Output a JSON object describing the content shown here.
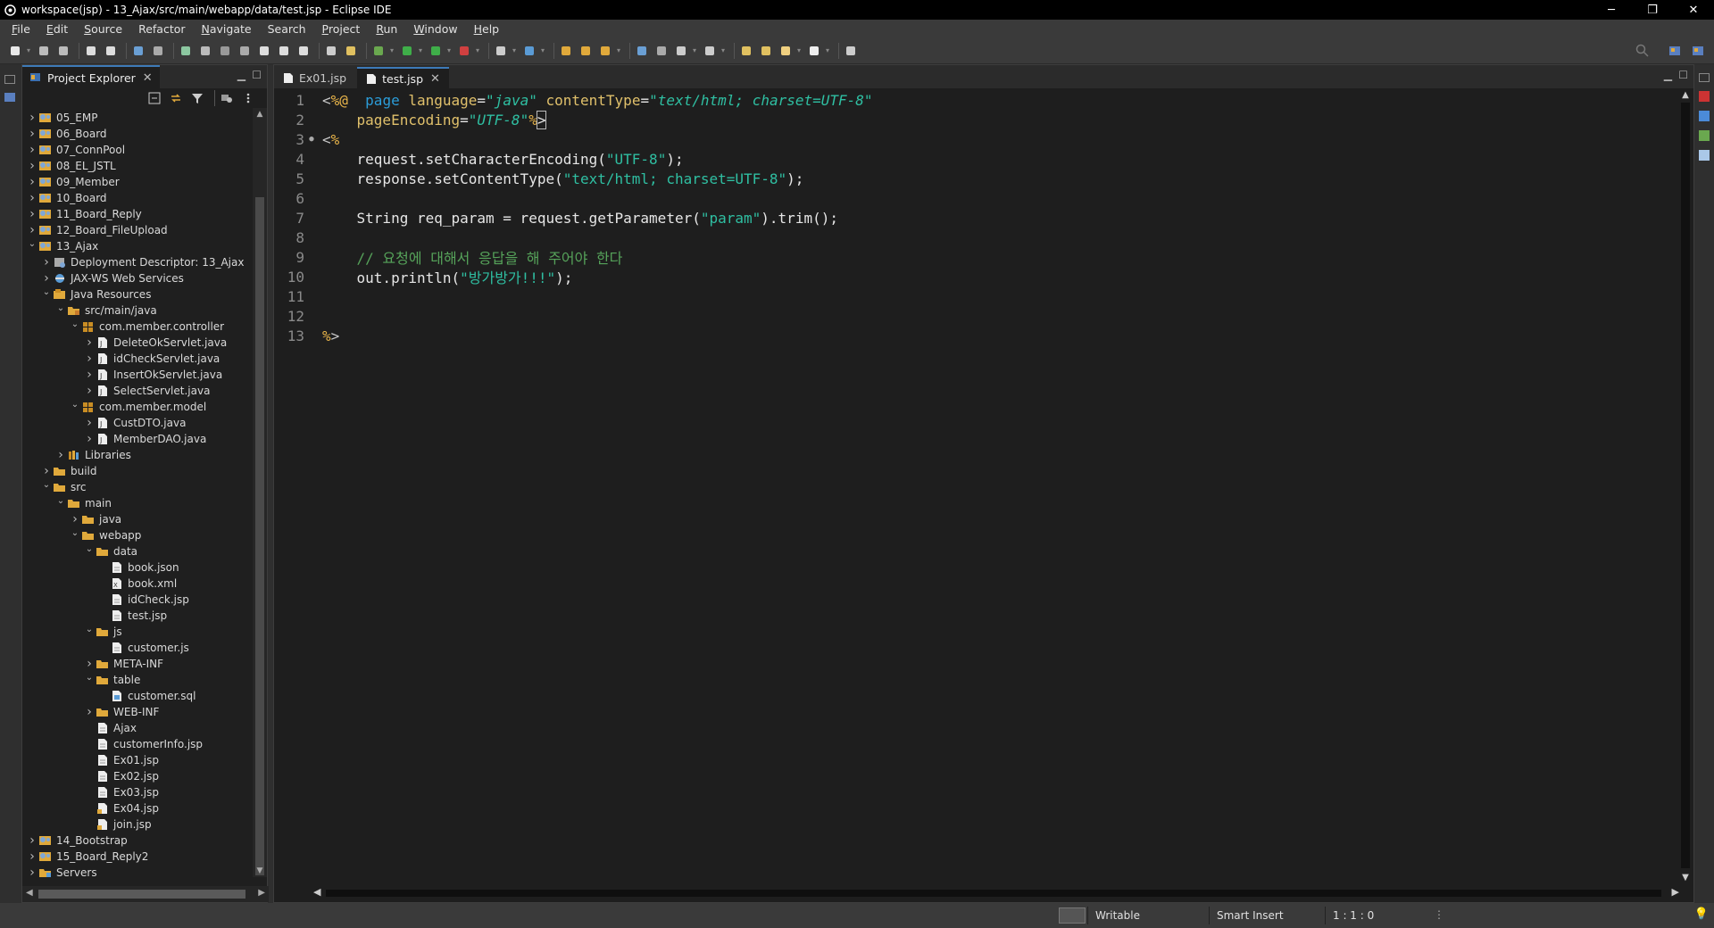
{
  "window": {
    "title": "workspace(jsp) - 13_Ajax/src/main/webapp/data/test.jsp - Eclipse IDE",
    "minimize": "─",
    "restore": "❐",
    "close": "✕"
  },
  "menu": [
    {
      "label": "File",
      "mnemonic": "F",
      "rest": "ile"
    },
    {
      "label": "Edit",
      "mnemonic": "E",
      "rest": "dit"
    },
    {
      "label": "Source",
      "mnemonic": "S",
      "rest": "ource"
    },
    {
      "label": "Refactor",
      "mnemonic": "",
      "rest": "Refactor"
    },
    {
      "label": "Navigate",
      "mnemonic": "N",
      "rest": "avigate"
    },
    {
      "label": "Search",
      "mnemonic": "",
      "rest": "Search"
    },
    {
      "label": "Project",
      "mnemonic": "P",
      "rest": "roject"
    },
    {
      "label": "Run",
      "mnemonic": "R",
      "rest": "un"
    },
    {
      "label": "Window",
      "mnemonic": "W",
      "rest": "indow"
    },
    {
      "label": "Help",
      "mnemonic": "H",
      "rest": "elp"
    }
  ],
  "explorer": {
    "tab_label": "Project Explorer",
    "tree": [
      {
        "label": "05_EMP",
        "depth": 0,
        "expanded": false,
        "icon": "project-icon"
      },
      {
        "label": "06_Board",
        "depth": 0,
        "expanded": false,
        "icon": "project-icon"
      },
      {
        "label": "07_ConnPool",
        "depth": 0,
        "expanded": false,
        "icon": "project-icon"
      },
      {
        "label": "08_EL_JSTL",
        "depth": 0,
        "expanded": false,
        "icon": "project-icon"
      },
      {
        "label": "09_Member",
        "depth": 0,
        "expanded": false,
        "icon": "project-icon"
      },
      {
        "label": "10_Board",
        "depth": 0,
        "expanded": false,
        "icon": "project-icon"
      },
      {
        "label": "11_Board_Reply",
        "depth": 0,
        "expanded": false,
        "icon": "project-icon"
      },
      {
        "label": "12_Board_FileUpload",
        "depth": 0,
        "expanded": false,
        "icon": "project-icon"
      },
      {
        "label": "13_Ajax",
        "depth": 0,
        "expanded": true,
        "icon": "project-icon"
      },
      {
        "label": "Deployment Descriptor: 13_Ajax",
        "depth": 1,
        "expanded": false,
        "icon": "descriptor-icon"
      },
      {
        "label": "JAX-WS Web Services",
        "depth": 1,
        "expanded": false,
        "icon": "webservice-icon"
      },
      {
        "label": "Java Resources",
        "depth": 1,
        "expanded": true,
        "icon": "java-resources-icon"
      },
      {
        "label": "src/main/java",
        "depth": 2,
        "expanded": true,
        "icon": "source-folder-icon"
      },
      {
        "label": "com.member.controller",
        "depth": 3,
        "expanded": true,
        "icon": "package-icon"
      },
      {
        "label": "DeleteOkServlet.java",
        "depth": 4,
        "expanded": false,
        "icon": "java-file-icon"
      },
      {
        "label": "idCheckServlet.java",
        "depth": 4,
        "expanded": false,
        "icon": "java-file-icon"
      },
      {
        "label": "InsertOkServlet.java",
        "depth": 4,
        "expanded": false,
        "icon": "java-file-icon"
      },
      {
        "label": "SelectServlet.java",
        "depth": 4,
        "expanded": false,
        "icon": "java-file-icon"
      },
      {
        "label": "com.member.model",
        "depth": 3,
        "expanded": true,
        "icon": "package-icon"
      },
      {
        "label": "CustDTO.java",
        "depth": 4,
        "expanded": false,
        "icon": "java-file-icon"
      },
      {
        "label": "MemberDAO.java",
        "depth": 4,
        "expanded": false,
        "icon": "java-file-icon"
      },
      {
        "label": "Libraries",
        "depth": 2,
        "expanded": false,
        "icon": "library-icon"
      },
      {
        "label": "build",
        "depth": 1,
        "expanded": false,
        "icon": "folder-icon"
      },
      {
        "label": "src",
        "depth": 1,
        "expanded": true,
        "icon": "folder-icon"
      },
      {
        "label": "main",
        "depth": 2,
        "expanded": true,
        "icon": "folder-icon"
      },
      {
        "label": "java",
        "depth": 3,
        "expanded": false,
        "icon": "folder-icon"
      },
      {
        "label": "webapp",
        "depth": 3,
        "expanded": true,
        "icon": "folder-icon"
      },
      {
        "label": "data",
        "depth": 4,
        "expanded": true,
        "icon": "folder-icon"
      },
      {
        "label": "book.json",
        "depth": 5,
        "leaf": true,
        "icon": "file-icon"
      },
      {
        "label": "book.xml",
        "depth": 5,
        "leaf": true,
        "icon": "xml-file-icon"
      },
      {
        "label": "idCheck.jsp",
        "depth": 5,
        "leaf": true,
        "icon": "file-icon"
      },
      {
        "label": "test.jsp",
        "depth": 5,
        "leaf": true,
        "icon": "file-icon"
      },
      {
        "label": "js",
        "depth": 4,
        "expanded": true,
        "icon": "folder-icon"
      },
      {
        "label": "customer.js",
        "depth": 5,
        "leaf": true,
        "icon": "file-icon"
      },
      {
        "label": "META-INF",
        "depth": 4,
        "expanded": false,
        "icon": "folder-icon"
      },
      {
        "label": "table",
        "depth": 4,
        "expanded": true,
        "icon": "folder-icon"
      },
      {
        "label": "customer.sql",
        "depth": 5,
        "leaf": true,
        "icon": "sql-file-icon"
      },
      {
        "label": "WEB-INF",
        "depth": 4,
        "expanded": false,
        "icon": "folder-icon"
      },
      {
        "label": "Ajax",
        "depth": 4,
        "leaf": true,
        "icon": "file-icon"
      },
      {
        "label": "customerInfo.jsp",
        "depth": 4,
        "leaf": true,
        "icon": "file-icon"
      },
      {
        "label": "Ex01.jsp",
        "depth": 4,
        "leaf": true,
        "icon": "file-icon"
      },
      {
        "label": "Ex02.jsp",
        "depth": 4,
        "leaf": true,
        "icon": "file-icon"
      },
      {
        "label": "Ex03.jsp",
        "depth": 4,
        "leaf": true,
        "icon": "file-icon"
      },
      {
        "label": "Ex04.jsp",
        "depth": 4,
        "leaf": true,
        "icon": "jsp-warning-file-icon"
      },
      {
        "label": "join.jsp",
        "depth": 4,
        "leaf": true,
        "icon": "jsp-warning-file-icon"
      },
      {
        "label": "14_Bootstrap",
        "depth": 0,
        "expanded": false,
        "icon": "project-icon"
      },
      {
        "label": "15_Board_Reply2",
        "depth": 0,
        "expanded": false,
        "icon": "project-icon"
      },
      {
        "label": "Servers",
        "depth": 0,
        "expanded": false,
        "icon": "servers-icon"
      }
    ]
  },
  "editor": {
    "tabs": [
      {
        "label": "Ex01.jsp",
        "active": false
      },
      {
        "label": "test.jsp",
        "active": true
      }
    ],
    "lines": [
      {
        "n": "1",
        "fold": "",
        "tokens": [
          [
            "k-tag",
            "<"
          ],
          [
            "k-pct",
            "%@"
          ],
          [
            "",
            "  "
          ],
          [
            "k-dir",
            "page"
          ],
          [
            "",
            " "
          ],
          [
            "k-attr",
            "language"
          ],
          [
            "",
            "="
          ],
          [
            "k-str",
            "\"java\""
          ],
          [
            "",
            " "
          ],
          [
            "k-attr",
            "contentType"
          ],
          [
            "",
            "="
          ],
          [
            "k-str",
            "\"text/html; charset=UTF-8\""
          ]
        ]
      },
      {
        "n": "2",
        "fold": "",
        "tokens": [
          [
            "",
            "    "
          ],
          [
            "k-attr",
            "pageEncoding"
          ],
          [
            "",
            "="
          ],
          [
            "k-str",
            "\"UTF-8\""
          ],
          [
            "k-pct",
            "%"
          ],
          [
            "caret-box",
            ">"
          ]
        ]
      },
      {
        "n": "3",
        "fold": "●",
        "tokens": [
          [
            "k-tag",
            "<"
          ],
          [
            "k-pct",
            "%"
          ]
        ]
      },
      {
        "n": "4",
        "fold": "",
        "tokens": [
          [
            "",
            "    request.setCharacterEncoding("
          ],
          [
            "k-jstr",
            "\"UTF-8\""
          ],
          [
            "",
            ");"
          ]
        ]
      },
      {
        "n": "5",
        "fold": "",
        "tokens": [
          [
            "",
            "    response.setContentType("
          ],
          [
            "k-jstr",
            "\"text/html; charset=UTF-8\""
          ],
          [
            "",
            ");"
          ]
        ]
      },
      {
        "n": "6",
        "fold": "",
        "tokens": []
      },
      {
        "n": "7",
        "fold": "",
        "tokens": [
          [
            "",
            "    String req_param = request.getParameter("
          ],
          [
            "k-jstr",
            "\"param\""
          ],
          [
            "",
            ").trim();"
          ]
        ]
      },
      {
        "n": "8",
        "fold": "",
        "tokens": []
      },
      {
        "n": "9",
        "fold": "",
        "tokens": [
          [
            "k-cmt",
            "    // 요청에 대해서 응답을 해 주어야 한다"
          ]
        ]
      },
      {
        "n": "10",
        "fold": "",
        "tokens": [
          [
            "",
            "    out.println("
          ],
          [
            "k-jstr",
            "\"방가방가!!!\""
          ],
          [
            "",
            ");"
          ]
        ]
      },
      {
        "n": "11",
        "fold": "",
        "tokens": []
      },
      {
        "n": "12",
        "fold": "",
        "tokens": []
      },
      {
        "n": "13",
        "fold": "",
        "tokens": [
          [
            "k-pct",
            "%"
          ],
          [
            "k-tag",
            ">"
          ]
        ]
      }
    ]
  },
  "status": {
    "writable": "Writable",
    "insert_mode": "Smart Insert",
    "position": "1 : 1 : 0"
  },
  "colors": {
    "accent": "#3d7ab8",
    "folder": "#e0a93b",
    "project": "#7fa7d6"
  }
}
